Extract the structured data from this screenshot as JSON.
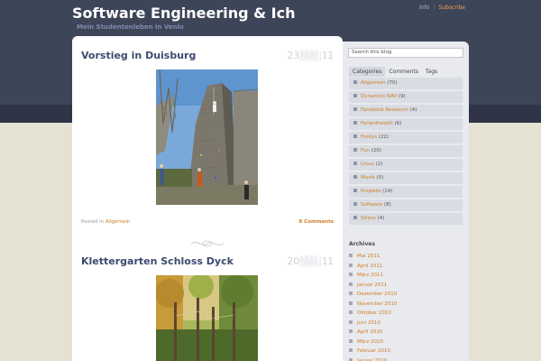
{
  "site": {
    "title": "Software Engineering & Ich",
    "description": "Mein Studentenleben in Venlo"
  },
  "top_links": {
    "info": "Info",
    "subscribe": "Subscribe"
  },
  "posts": [
    {
      "title": "Vorstieg in Duisburg",
      "date": {
        "day": "23",
        "month": "MAI",
        "year": "11"
      },
      "meta_prefix": "Posted in",
      "category": "Allgemein",
      "comments": "8 Comments"
    },
    {
      "title": "Klettergarten Schloss Dyck",
      "date": {
        "day": "20",
        "month": "MAI",
        "year": "11"
      }
    }
  ],
  "sidebar": {
    "search_placeholder": "Search this blog",
    "tabs": [
      "Categories",
      "Comments",
      "Tags"
    ],
    "categories": [
      {
        "name": "Allgemein",
        "count": "(70)"
      },
      {
        "name": "Dynamics NAV",
        "count": "(9)"
      },
      {
        "name": "Facebook Research",
        "count": "(4)"
      },
      {
        "name": "Ferienfreizeit",
        "count": "(6)"
      },
      {
        "name": "Fontys",
        "count": "(22)"
      },
      {
        "name": "Fun",
        "count": "(20)"
      },
      {
        "name": "Linux",
        "count": "(2)"
      },
      {
        "name": "Musik",
        "count": "(5)"
      },
      {
        "name": "Projekte",
        "count": "(14)"
      },
      {
        "name": "Software",
        "count": "(8)"
      },
      {
        "name": "Stress",
        "count": "(4)"
      }
    ],
    "archives_heading": "Archives",
    "archives": [
      "Mai 2011",
      "April 2011",
      "März 2011",
      "Januar 2011",
      "Dezember 2010",
      "November 2010",
      "Oktober 2010",
      "Juni 2010",
      "April 2010",
      "März 2010",
      "Februar 2010",
      "Januar 2010"
    ]
  },
  "colors": {
    "header": "#3d4558",
    "accent": "#d07d26",
    "title": "#3c4b6e",
    "background": "#e5e1d3"
  }
}
